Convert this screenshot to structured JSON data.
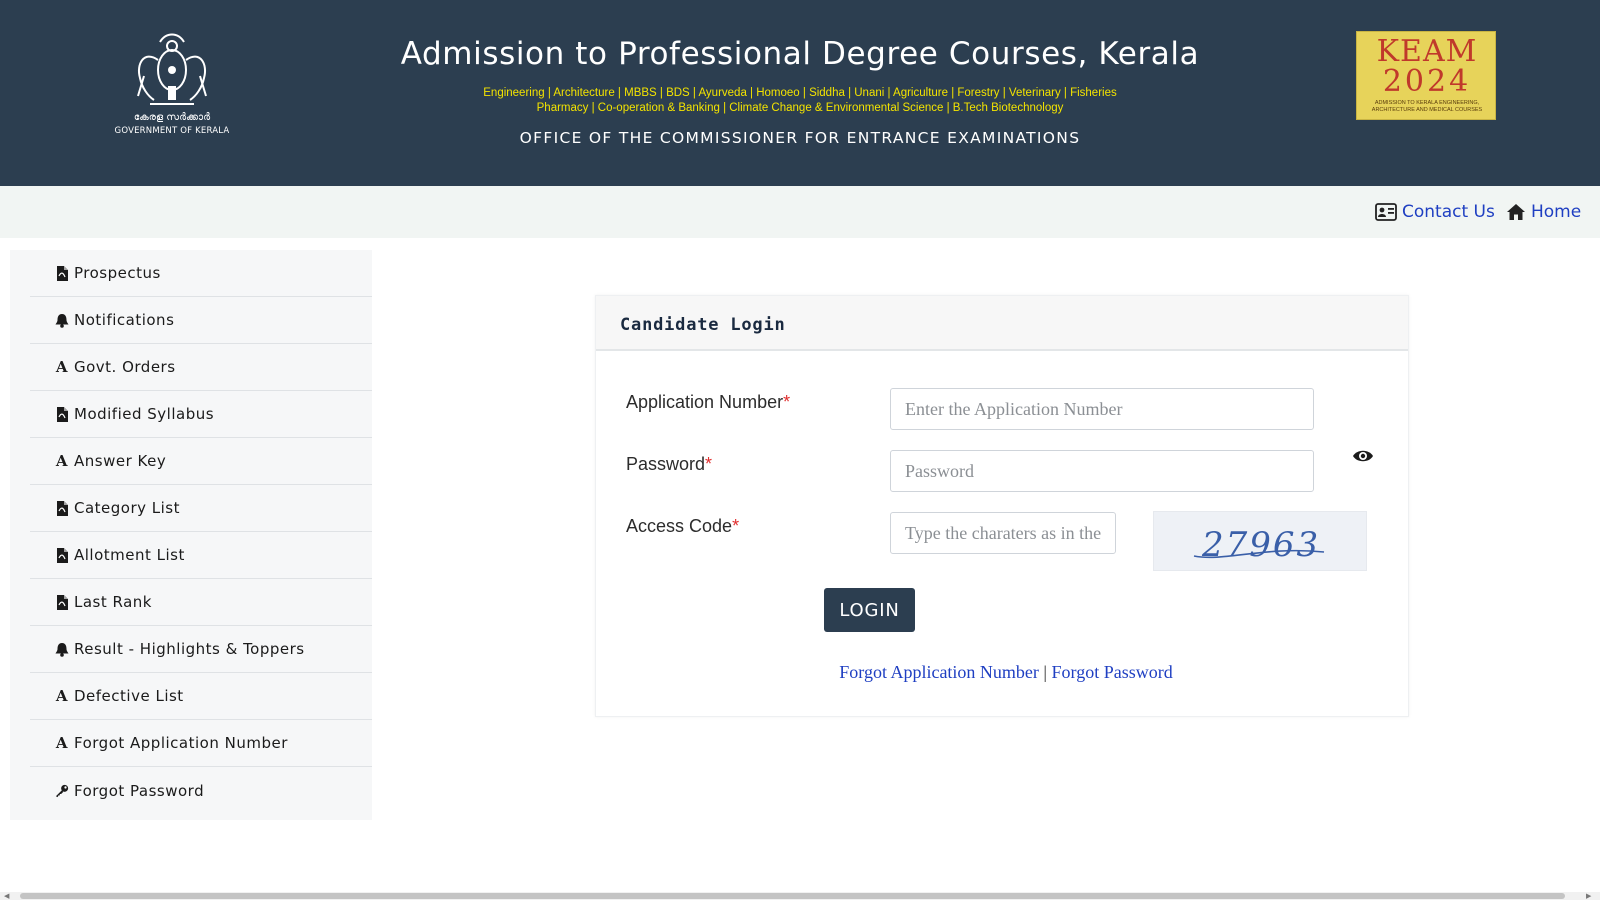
{
  "header": {
    "emblem_malayalam": "കേരള സർക്കാർ",
    "emblem_caption": "GOVERNMENT OF KERALA",
    "title": "Admission to Professional Degree Courses, Kerala",
    "courses_line1": "Engineering | Architecture | MBBS | BDS | Ayurveda | Homoeo | Siddha | Unani | Agriculture | Forestry | Veterinary | Fisheries",
    "courses_line2": "Pharmacy | Co-operation & Banking | Climate Change & Environmental Science | B.Tech Biotechnology",
    "office": "OFFICE OF THE COMMISSIONER FOR ENTRANCE EXAMINATIONS",
    "logo": {
      "line1": "KEAM",
      "line2": "2024",
      "subtext": "ADMISSION TO KERALA ENGINEERING, ARCHITECTURE AND MEDICAL COURSES"
    }
  },
  "topnav": {
    "contact": "Contact Us",
    "home": "Home"
  },
  "sidebar": {
    "items": [
      {
        "label": "Prospectus",
        "icon": "pdf-icon"
      },
      {
        "label": "Notifications",
        "icon": "bell-icon"
      },
      {
        "label": "Govt. Orders",
        "icon": "letter-a-icon"
      },
      {
        "label": "Modified Syllabus",
        "icon": "pdf-icon"
      },
      {
        "label": "Answer Key",
        "icon": "letter-a-icon"
      },
      {
        "label": "Category List",
        "icon": "pdf-icon"
      },
      {
        "label": "Allotment List",
        "icon": "pdf-icon"
      },
      {
        "label": "Last Rank",
        "icon": "pdf-icon"
      },
      {
        "label": "Result - Highlights & Toppers",
        "icon": "bell-icon"
      },
      {
        "label": "Defective List",
        "icon": "letter-a-icon"
      },
      {
        "label": "Forgot Application Number",
        "icon": "letter-a-icon"
      },
      {
        "label": "Forgot Password",
        "icon": "key-icon"
      }
    ]
  },
  "login": {
    "title": "Candidate Login",
    "app_label": "Application Number",
    "app_placeholder": "Enter the Application Number",
    "pwd_label": "Password",
    "pwd_placeholder": "Password",
    "code_label": "Access Code",
    "code_placeholder": "Type the charaters as in the image",
    "required_mark": "*",
    "captcha_text": "27963",
    "button": "LOGIN",
    "forgot_app": "Forgot Application Number",
    "separator": "|",
    "forgot_pwd": "Forgot Password"
  },
  "colors": {
    "header_bg": "#2c3e50",
    "course_text": "#f3e300",
    "link": "#1f3fc2",
    "required": "#e02d2d",
    "button_bg": "#2c3e50"
  }
}
